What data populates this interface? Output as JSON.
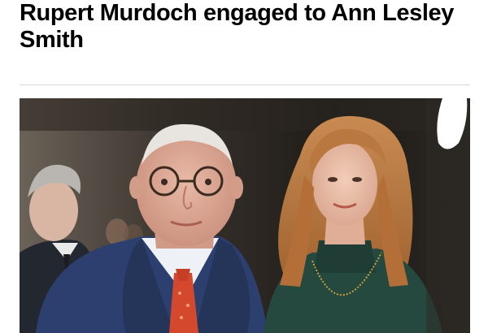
{
  "article": {
    "headline": "Rupert Murdoch engaged to Ann Lesley Smith"
  },
  "photo": {
    "subject": "photo-couple"
  }
}
